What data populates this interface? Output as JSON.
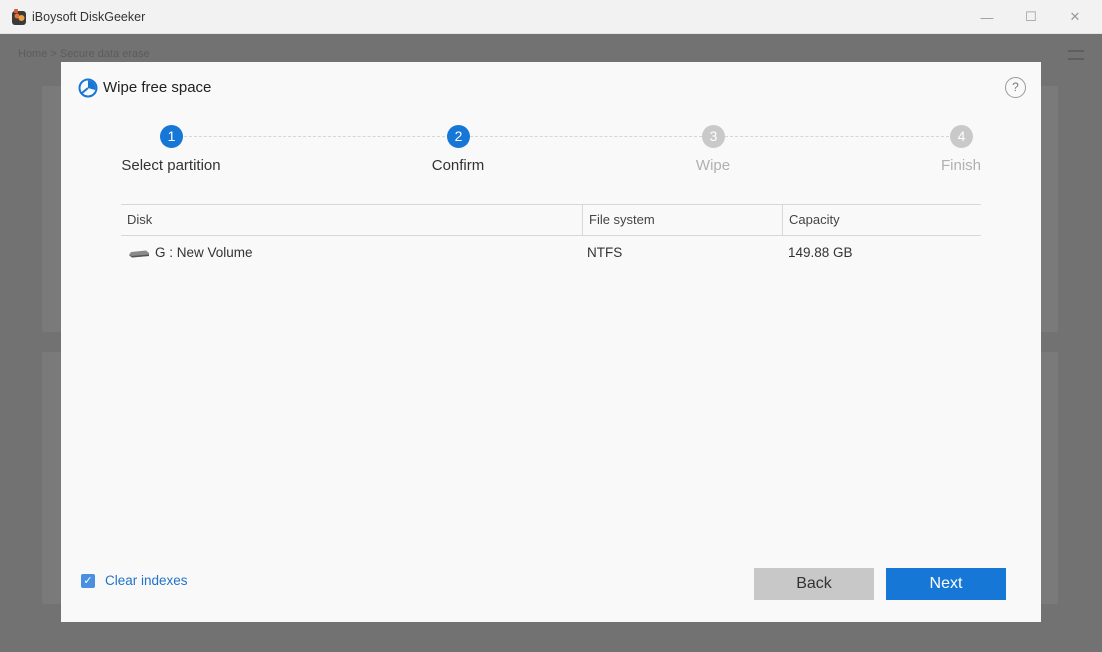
{
  "window": {
    "title": "iBoysoft DiskGeeker",
    "minimize_glyph": "—",
    "maximize_glyph": "☐",
    "close_glyph": "✕"
  },
  "background": {
    "breadcrumb": "Home  >  Secure data erase"
  },
  "dialog": {
    "title": "Wipe free space",
    "help_glyph": "?",
    "steps": [
      {
        "number": "1",
        "label": "Select partition",
        "state": "done"
      },
      {
        "number": "2",
        "label": "Confirm",
        "state": "active"
      },
      {
        "number": "3",
        "label": "Wipe",
        "state": "pending"
      },
      {
        "number": "4",
        "label": "Finish",
        "state": "pending"
      }
    ],
    "table": {
      "columns": [
        "Disk",
        "File system",
        "Capacity"
      ],
      "rows": [
        {
          "disk": "G : New Volume",
          "file_system": "NTFS",
          "capacity": "149.88 GB"
        }
      ]
    },
    "clear_indexes": {
      "label": "Clear indexes",
      "checked": true,
      "check_glyph": "✓"
    },
    "buttons": {
      "back": "Back",
      "next": "Next"
    }
  },
  "colors": {
    "accent": "#1677d6",
    "inactive_step": "#c9c9c9"
  }
}
